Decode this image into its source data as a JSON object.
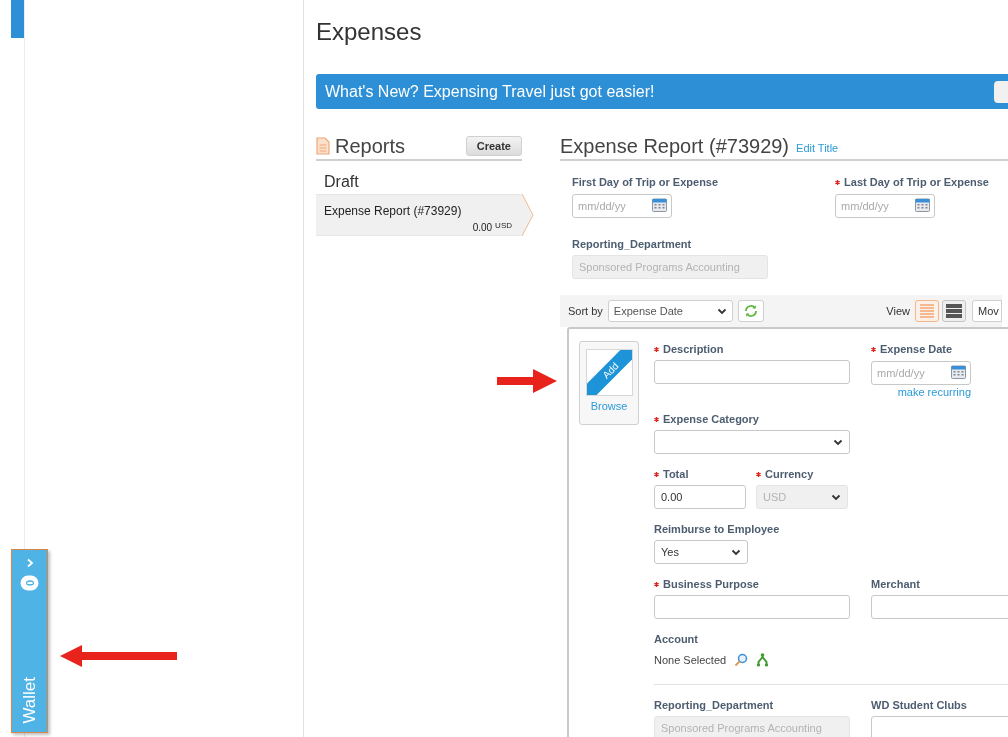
{
  "page_title": "Expenses",
  "banner": {
    "text": "What's New? Expensing Travel just got easier!"
  },
  "reports": {
    "title": "Reports",
    "create_button": "Create",
    "group": "Draft",
    "items": [
      {
        "name": "Expense Report (#73929)",
        "amount": "0.00",
        "currency": "USD",
        "selected": true
      }
    ]
  },
  "report": {
    "title": "Expense Report (#73929)",
    "edit_link": "Edit Title",
    "header_fields": [
      {
        "label": "First Day of Trip or Expense",
        "required": false,
        "kind": "date",
        "placeholder": "mm/dd/yy"
      },
      {
        "label": "Last Day of Trip or Expense",
        "required": true,
        "kind": "date",
        "placeholder": "mm/dd/yy"
      },
      {
        "label": "Reporting_Department",
        "required": false,
        "kind": "text",
        "value": "Sponsored Programs Accounting",
        "disabled": true
      }
    ]
  },
  "toolbar": {
    "sort_label": "Sort by",
    "sort_value": "Expense Date",
    "view_label": "View",
    "view_options": [
      {
        "selected": true
      },
      {
        "selected": false
      }
    ],
    "move_button": "Mov"
  },
  "receipt": {
    "badge": "Add",
    "link": "Browse"
  },
  "form_rows": [
    {
      "left": [
        {
          "label": "Description",
          "required": true,
          "kind": "text"
        }
      ],
      "right": [
        {
          "label": "Expense Date",
          "required": true,
          "kind": "date",
          "placeholder": "mm/dd/yy",
          "link": "make recurring"
        }
      ]
    },
    {
      "left": [
        {
          "label": "Expense Category",
          "required": true,
          "kind": "select"
        }
      ],
      "right": []
    },
    {
      "left": [
        {
          "label": "Total",
          "required": true,
          "kind": "text",
          "value": "0.00"
        },
        {
          "label": "Currency",
          "required": true,
          "kind": "select",
          "value": "USD",
          "disabled": true
        }
      ],
      "right": []
    },
    {
      "left": [
        {
          "label": "Reimburse to Employee",
          "required": false,
          "kind": "small-select",
          "value": "Yes"
        }
      ],
      "right": []
    },
    {
      "left": [
        {
          "label": "Business Purpose",
          "required": true,
          "kind": "text"
        }
      ],
      "right": [
        {
          "label": "Merchant",
          "required": false,
          "kind": "text"
        }
      ]
    },
    {
      "left": [
        {
          "label": "Account",
          "required": false,
          "kind": "account",
          "value": "None Selected"
        }
      ],
      "right": []
    },
    {
      "left": [
        {
          "label": "Reporting_Department",
          "required": false,
          "kind": "text",
          "value": "Sponsored Programs Accounting",
          "disabled": true
        }
      ],
      "right": [
        {
          "label": "WD Student Clubs",
          "required": false,
          "kind": "text"
        }
      ],
      "divider": true
    }
  ],
  "wallet": {
    "label": "Wallet",
    "count": "0"
  }
}
